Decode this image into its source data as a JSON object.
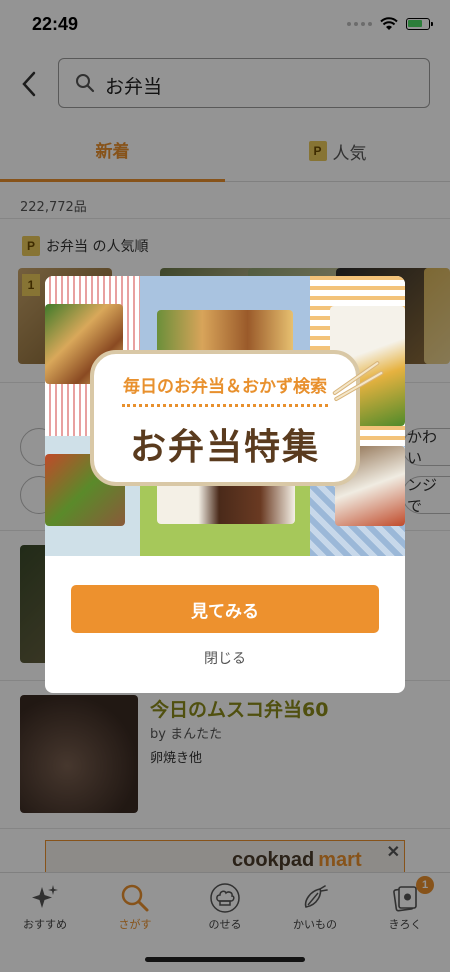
{
  "status": {
    "time": "22:49"
  },
  "search": {
    "query": "お弁当"
  },
  "tabs": [
    {
      "label": "新着"
    },
    {
      "label": "人気",
      "badge": "P"
    }
  ],
  "results": {
    "count": "222,772品"
  },
  "ranking": {
    "badge": "P",
    "title": "お弁当 の人気順",
    "rank_badge": "1"
  },
  "suggestions": [
    {
      "label": "かわい"
    },
    {
      "label": "ンジで"
    }
  ],
  "recipe": {
    "title": "今日のムスコ弁当60",
    "author": "by まんたた",
    "ingredients": "卵焼き他"
  },
  "ad": {
    "logo": "cookpad",
    "logo_sub": "mart",
    "close": "✕"
  },
  "nav": [
    {
      "label": "おすすめ",
      "icon": "sparkle-icon"
    },
    {
      "label": "さがす",
      "icon": "search-icon",
      "active": true
    },
    {
      "label": "のせる",
      "icon": "chef-hat-icon"
    },
    {
      "label": "かいもの",
      "icon": "vegetable-icon"
    },
    {
      "label": "きろく",
      "icon": "recipe-book-icon",
      "badge": "1"
    }
  ],
  "modal": {
    "subtitle": "毎日のお弁当＆おかず検索",
    "title": "お弁当特集",
    "cta": "見てみる",
    "close": "閉じる"
  },
  "colors": {
    "accent": "#ed912e",
    "title_brown": "#5a3b1e",
    "recipe_title": "#8a8a1a"
  }
}
